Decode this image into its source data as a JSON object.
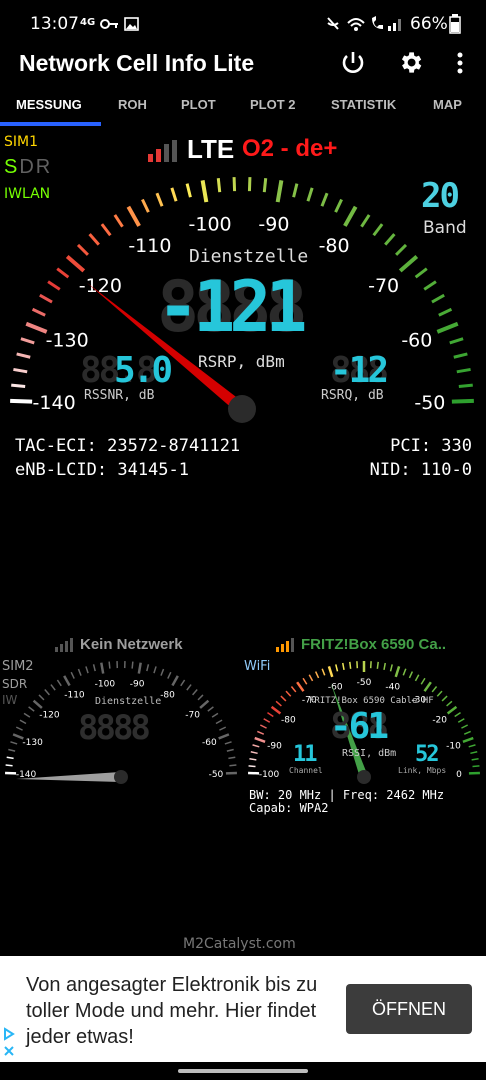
{
  "status_bar": {
    "time": "13:07",
    "network": "4G",
    "battery": "66%"
  },
  "app": {
    "title": "Network Cell Info Lite"
  },
  "tabs": [
    {
      "label": "MESSUNG",
      "active": true
    },
    {
      "label": "ROH"
    },
    {
      "label": "PLOT"
    },
    {
      "label": "PLOT 2"
    },
    {
      "label": "STATISTIK"
    },
    {
      "label": "MAP"
    }
  ],
  "main_gauge": {
    "sim": "SIM1",
    "sdr": {
      "s": "S",
      "d": "D",
      "r": "R"
    },
    "wlan": "IWLAN",
    "tech": "LTE",
    "operator": "O2 - de+",
    "band_value": "20",
    "band_label": "Band",
    "cell_label": "Dienstzelle",
    "value": "-121",
    "unit": "RSRP, dBm",
    "rssnr_value": "5.0",
    "rssnr_label": "RSSNR, dB",
    "rsrq_value": "-12",
    "rsrq_label": "RSRQ, dB",
    "scale": [
      "-140",
      "-130",
      "-120",
      "-110",
      "-100",
      "-90",
      "-80",
      "-70",
      "-60",
      "-50"
    ],
    "needle_value": -121
  },
  "cell_info": {
    "tac_eci": "TAC-ECI: 23572-8741121",
    "pci": "PCI: 330",
    "enb": "eNB-LCID: 34145-1",
    "nid": "NID: 110-0"
  },
  "sim2_gauge": {
    "header": "Kein Netzwerk",
    "sim": "SIM2",
    "sdr": "SDR",
    "iw": "IW",
    "cell_label": "Dienstzelle",
    "scale": [
      "-140",
      "-130",
      "-120",
      "-110",
      "-100",
      "-90",
      "-80",
      "-70",
      "-60",
      "-50"
    ]
  },
  "wifi_gauge": {
    "header": "FRITZ!Box 6590 Ca..",
    "wifi_label": "WiFi",
    "ssid": "FRITZ!Box 6590 Cable HF",
    "value": "-61",
    "unit": "RSSI, dBm",
    "channel_value": "11",
    "channel_label": "Channel",
    "link_value": "52",
    "link_label": "Link, Mbps",
    "scale": [
      "-100",
      "-90",
      "-80",
      "-70",
      "-60",
      "-50",
      "-40",
      "-30",
      "-20",
      "-10",
      "0"
    ],
    "bw_line": "BW: 20 MHz | Freq: 2462 MHz",
    "capab_line": "Capab: WPA2",
    "needle_value": -61
  },
  "footer": {
    "brand": "M2Catalyst.com"
  },
  "ad": {
    "text": "Von angesagter Elektronik bis zu toller Mode und mehr. Hier findet jeder etwas!",
    "button": "ÖFFNEN"
  }
}
